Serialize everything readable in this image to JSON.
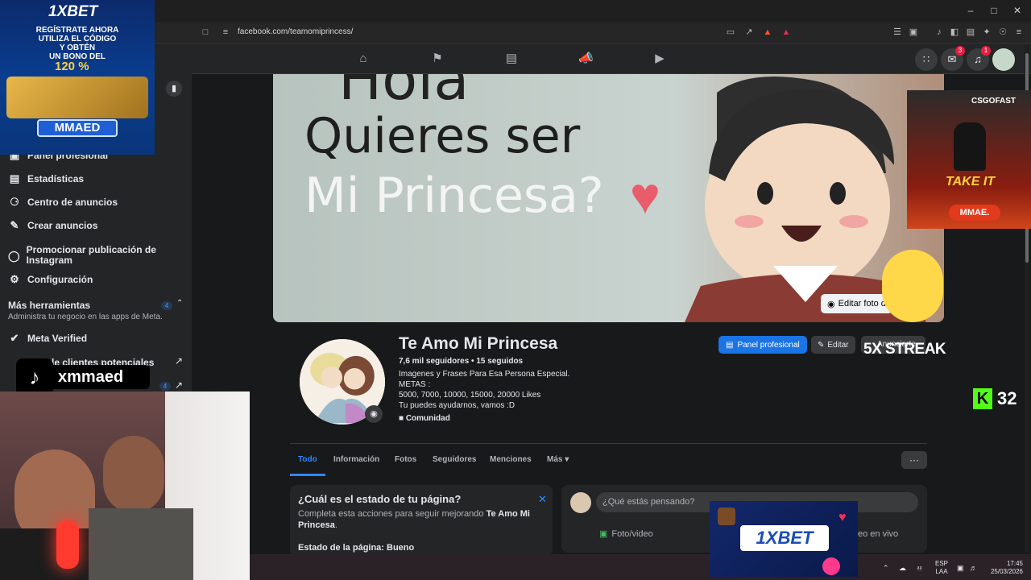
{
  "browser": {
    "url": "facebook.com/teamomiprincess/"
  },
  "nav": {
    "messenger_badge": "3",
    "notifications_badge": "1"
  },
  "sidebar": {
    "items": [
      {
        "label": "Panel profesional",
        "icon": "briefcase-icon"
      },
      {
        "label": "Estadísticas",
        "icon": "insights-icon"
      },
      {
        "label": "Centro de anuncios",
        "icon": "megaphone-icon"
      },
      {
        "label": "Crear anuncios",
        "icon": "pencil-icon"
      },
      {
        "label": "Promocionar publicación de Instagram",
        "icon": "instagram-icon"
      },
      {
        "label": "Configuración",
        "icon": "gear-icon"
      }
    ],
    "more_tools": {
      "title": "Más herramientas",
      "count": "4",
      "subtitle": "Administra tu negocio en las apps de Meta."
    },
    "meta_verified": "Meta Verified",
    "leads": "de clientes potenciales",
    "leads_count": "4"
  },
  "cover": {
    "line0": "Hola",
    "line1": "Quieres ser",
    "line2": "Mi Princesa?",
    "edit_label": "Editar foto d"
  },
  "profile": {
    "name": "Te Amo Mi Princesa",
    "followers": "7,6 mil seguidores • 15 seguidos",
    "bio": [
      "Imagenes y Frases Para Esa Persona Especial.",
      "METAS :",
      "5000, 7000, 10000, 15000, 20000 Likes",
      "Tu puedes ayudarnos, vamos :D"
    ],
    "category": "Comunidad",
    "btn_panel": "Panel profesional",
    "btn_edit": "Editar",
    "btn_promote": "Anunciarte"
  },
  "tabs": [
    "Todo",
    "Información",
    "Fotos",
    "Seguidores",
    "Menciones",
    "Más"
  ],
  "status_card": {
    "title": "¿Cuál es el estado de tu página?",
    "desc_prefix": "Completa esta acciones para seguir mejorando",
    "desc_name": "Te Amo Mi Princesa",
    "state": "Estado de la página: Bueno"
  },
  "post_card": {
    "placeholder": "¿Qué estás pensando?",
    "photo_video": "Foto/video",
    "live": "eo en vivo"
  },
  "overlays": {
    "ad_top": {
      "brand": "1XBET",
      "line1": "REGÍSTRATE AHORA",
      "line2": "UTILIZA EL CÓDIGO",
      "line3": "Y OBTÉN",
      "line4": "UN BONO DEL",
      "percent": "120 %",
      "code": "MMAED"
    },
    "ad_right": {
      "brand": "CSGOFAST",
      "tag": "TAKE IT",
      "code": "MMAE."
    },
    "ad_bottom": {
      "brand": "1XBET"
    },
    "streak": "5X STREAK",
    "kick_count": "32",
    "tiktok_handle": "xmmaed"
  },
  "taskbar": {
    "lang1": "ESP",
    "lang2": "LAA",
    "time": "17:45",
    "date": "25/03/2026"
  }
}
